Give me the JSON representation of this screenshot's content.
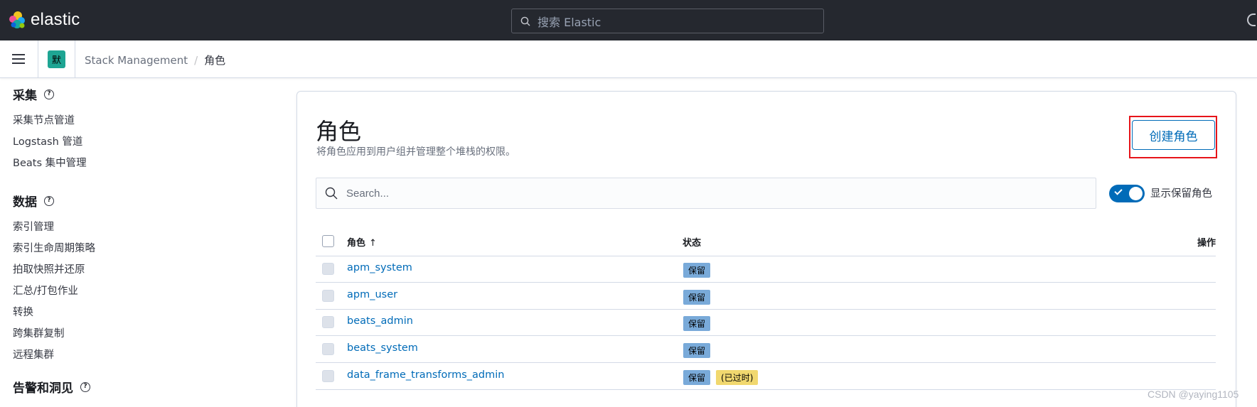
{
  "header": {
    "logo_text": "elastic",
    "search_placeholder": "搜索 Elastic"
  },
  "subheader": {
    "space_badge": "默",
    "breadcrumbs": [
      "Stack Management",
      "角色"
    ]
  },
  "sidebar": {
    "groups": [
      {
        "title": "采集",
        "items": [
          "采集节点管道",
          "Logstash 管道",
          "Beats 集中管理"
        ]
      },
      {
        "title": "数据",
        "items": [
          "索引管理",
          "索引生命周期策略",
          "拍取快照并还原",
          "汇总/打包作业",
          "转换",
          "跨集群复制",
          "远程集群"
        ]
      },
      {
        "title": "告警和洞见",
        "items": []
      }
    ]
  },
  "main": {
    "title": "角色",
    "description": "将角色应用到用户组并管理整个堆栈的权限。",
    "create_button": "创建角色",
    "search_placeholder": "Search...",
    "toggle_label": "显示保留角色",
    "toggle_on": true,
    "table": {
      "columns": [
        "角色",
        "状态",
        "操作"
      ],
      "sort_indicator": "↑",
      "rows": [
        {
          "name": "apm_system",
          "badges": [
            "保留"
          ]
        },
        {
          "name": "apm_user",
          "badges": [
            "保留"
          ]
        },
        {
          "name": "beats_admin",
          "badges": [
            "保留"
          ]
        },
        {
          "name": "beats_system",
          "badges": [
            "保留"
          ]
        },
        {
          "name": "data_frame_transforms_admin",
          "badges": [
            "保留",
            "(已过时)"
          ]
        }
      ]
    }
  },
  "watermark": "CSDN @yaying1105",
  "colors": {
    "header_bg": "#25282f",
    "accent": "#006bb8",
    "space_badge": "#1ea593",
    "reserved_badge": "#79aad9",
    "deprecated_badge": "#f1d86f",
    "highlight_box": "#e7141a"
  }
}
